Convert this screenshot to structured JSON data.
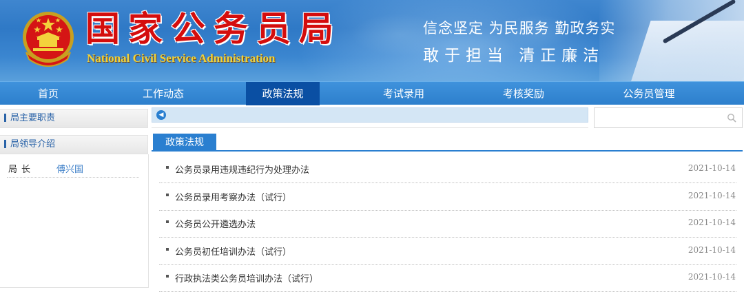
{
  "header": {
    "title_cn": "国家公务员局",
    "title_en": "National Civil Service Administration",
    "slogan_line1": "信念坚定 为民服务 勤政务实",
    "slogan_line2": "敢于担当 清正廉洁",
    "emblem_icon": "national-emblem-icon",
    "colors": {
      "title": "#d40d0d",
      "title_en": "#f0d23a",
      "banner": "#2f79c6"
    }
  },
  "nav": {
    "items": [
      {
        "label": "首页"
      },
      {
        "label": "工作动态"
      },
      {
        "label": "政策法规",
        "active": true
      },
      {
        "label": "考试录用"
      },
      {
        "label": "考核奖励"
      },
      {
        "label": "公务员管理"
      }
    ],
    "colors": {
      "bar": "#2d7fcc",
      "active": "#0a4fa3"
    }
  },
  "sidebar": {
    "sections": [
      {
        "label": "局主要职责"
      },
      {
        "label": "局领导介绍"
      }
    ],
    "leaders": [
      {
        "title": "局长",
        "name": "傅兴国"
      }
    ]
  },
  "ticker": {
    "arrow_icon": "left-arrow-icon"
  },
  "search": {
    "placeholder": "",
    "icon": "search-icon"
  },
  "main": {
    "tab": "政策法规",
    "items": [
      {
        "title": "公务员录用违规违纪行为处理办法",
        "date": "2021-10-14"
      },
      {
        "title": "公务员录用考察办法（试行）",
        "date": "2021-10-14"
      },
      {
        "title": "公务员公开遴选办法",
        "date": "2021-10-14"
      },
      {
        "title": "公务员初任培训办法（试行）",
        "date": "2021-10-14"
      },
      {
        "title": "行政执法类公务员培训办法（试行）",
        "date": "2021-10-14"
      }
    ]
  }
}
